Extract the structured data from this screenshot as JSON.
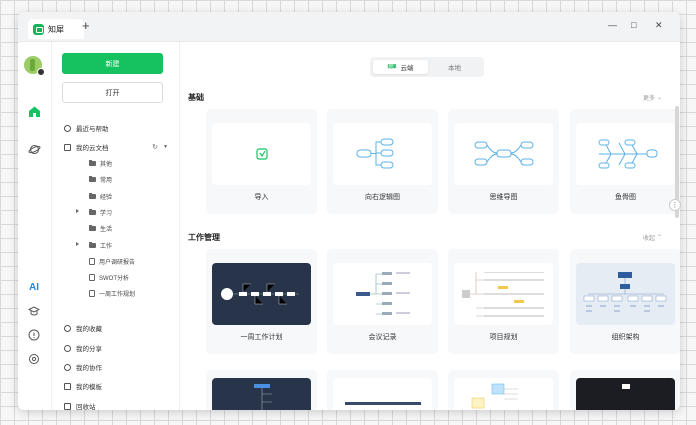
{
  "window": {
    "tab_title": "知犀",
    "add_tab": "+",
    "controls": {
      "minimize": "—",
      "maximize": "□",
      "close": "✕"
    }
  },
  "rail": {
    "ai_label": "AI"
  },
  "sidebar": {
    "new_label": "新建",
    "open_label": "打开",
    "recent": "最近与帮助",
    "my_cloud": "我的云文档",
    "tree": [
      {
        "label": "其他",
        "type": "folder",
        "expandable": false
      },
      {
        "label": "常用",
        "type": "folder",
        "expandable": false
      },
      {
        "label": "经验",
        "type": "folder",
        "expandable": false
      },
      {
        "label": "学习",
        "type": "folder",
        "expandable": true
      },
      {
        "label": "生活",
        "type": "folder",
        "expandable": false
      },
      {
        "label": "工作",
        "type": "folder",
        "expandable": true
      },
      {
        "label": "用户调研报告",
        "type": "doc",
        "expandable": false
      },
      {
        "label": "SWOT分析",
        "type": "doc",
        "expandable": false
      },
      {
        "label": "一周工作规划",
        "type": "doc",
        "expandable": false
      }
    ],
    "bottom": [
      {
        "label": "我的收藏"
      },
      {
        "label": "我的分享"
      },
      {
        "label": "我的协作"
      },
      {
        "label": "我的模板"
      },
      {
        "label": "回收站"
      }
    ]
  },
  "main": {
    "segment": {
      "cloud_badge": "知犀",
      "cloud": "云端",
      "local": "本地"
    },
    "basic": {
      "title": "基础",
      "more": "更多",
      "cards": [
        {
          "label": "导入"
        },
        {
          "label": "向右逻辑图"
        },
        {
          "label": "思维导图"
        },
        {
          "label": "鱼骨图"
        }
      ]
    },
    "work": {
      "title": "工作管理",
      "collapse": "收起",
      "cards": [
        {
          "label": "一周工作计划"
        },
        {
          "label": "会议记录"
        },
        {
          "label": "项目规划"
        },
        {
          "label": "组织架构"
        }
      ]
    }
  },
  "colors": {
    "accent": "#16c260",
    "node": "#5bb2e6"
  }
}
